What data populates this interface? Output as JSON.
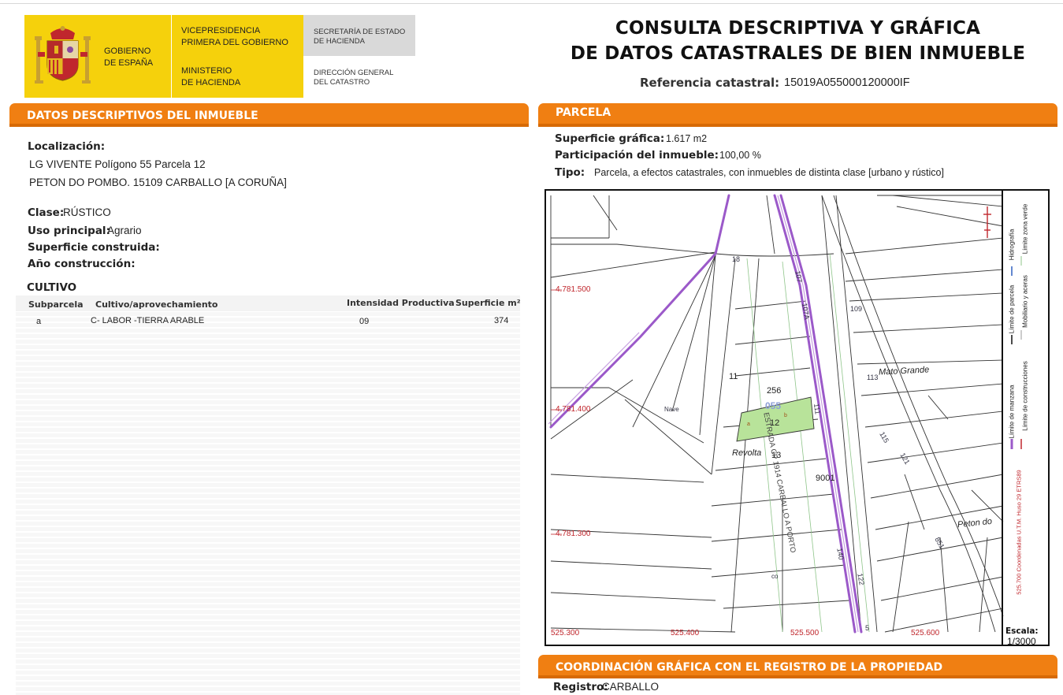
{
  "header": {
    "logo": {
      "gobierno": [
        "GOBIERNO",
        "DE ESPAÑA"
      ],
      "vicepresidencia": [
        "VICEPRESIDENCIA",
        "PRIMERA DEL GOBIERNO"
      ],
      "ministerio": [
        "MINISTERIO",
        "DE HACIENDA"
      ],
      "secretaria": [
        "SECRETARÍA DE ESTADO",
        "DE HACIENDA"
      ],
      "direccion": [
        "DIRECCIÓN GENERAL",
        "DEL CATASTRO"
      ]
    },
    "title_line1": "CONSULTA DESCRIPTIVA Y GRÁFICA",
    "title_line2": "DE DATOS CATASTRALES DE BIEN INMUEBLE",
    "ref_label": "Referencia catastral:",
    "ref_value": "15019A055000120000IF"
  },
  "descriptivos": {
    "title": "DATOS DESCRIPTIVOS DEL INMUEBLE",
    "localizacion_label": "Localización:",
    "localizacion_line1": "LG VIVENTE  Polígono 55 Parcela 12",
    "localizacion_line2": "PETON DO POMBO. 15109 CARBALLO [A CORUÑA]",
    "clase_label": "Clase:",
    "clase_value": "RÚSTICO",
    "uso_label": "Uso principal:",
    "uso_value": "Agrario",
    "superficie_label": "Superficie construida:",
    "anio_label": "Año construcción:"
  },
  "cultivo": {
    "title": "CULTIVO",
    "columns": [
      "Subparcela",
      "Cultivo/aprovechamiento",
      "Intensidad Productiva",
      "Superficie m²"
    ],
    "rows": [
      {
        "subparcela": "a",
        "cultivo": "C- LABOR -TIERRA ARABLE",
        "intensidad": "09",
        "superficie": "374"
      }
    ]
  },
  "parcela": {
    "title": "PARCELA",
    "superficie_label": "Superficie gráfica:",
    "superficie_value": "1.617 m2",
    "participacion_label": "Participación del inmueble:",
    "participacion_value": "100,00 %",
    "tipo_label": "Tipo:",
    "tipo_value": "Parcela, a efectos catastrales, con inmuebles de distinta clase [urbano y rústico]"
  },
  "map": {
    "y_coords": [
      "4.781.500",
      "4.781.400",
      "4.781.300"
    ],
    "x_coords": [
      "525.300",
      "525.400",
      "525.500",
      "525.600"
    ],
    "labels": {
      "parcel_num": "12",
      "poligono": "055",
      "sub_a": "a",
      "sub_b": "b",
      "p256": "256",
      "p11": "11",
      "p13": "13",
      "p9001": "9001",
      "p111": "111",
      "p113": "113",
      "p115": "115",
      "p109": "109",
      "p107": "107",
      "p107a": "107A",
      "p108": "108",
      "p121": "121",
      "p18": "18",
      "p122": "122",
      "p140": "140",
      "p5": "5",
      "p851": "851",
      "p57": "57",
      "co": "co",
      "nave": "Nave",
      "mato_grande": "Mato Grande",
      "revolta": "Revolta",
      "peton": "Peton do",
      "road": "ESTRADA CP 1914 CARBALLO A PORTO"
    },
    "legend": {
      "col1": [
        "Límite de manzana",
        "Límite de parcela",
        "Hidrografía"
      ],
      "col2": [
        "Límite de construcciones",
        "Mobiliario y aceras",
        "Límite zona verde"
      ],
      "coords_note": "525.700 Coordenadas U.T.M. Huso 29 ETRS89"
    },
    "scale_label": "Escala:",
    "scale_value": "1/3000"
  },
  "coordinacion": {
    "title": "COORDINACIÓN GRÁFICA CON EL REGISTRO DE LA PROPIEDAD",
    "registro_label": "Registro:",
    "registro_value": "CARBALLO"
  },
  "colors": {
    "orange": "#f07f12",
    "yellow": "#f5d10c",
    "parcel_fill": "#b8e39a",
    "road": "#9b59c9"
  }
}
